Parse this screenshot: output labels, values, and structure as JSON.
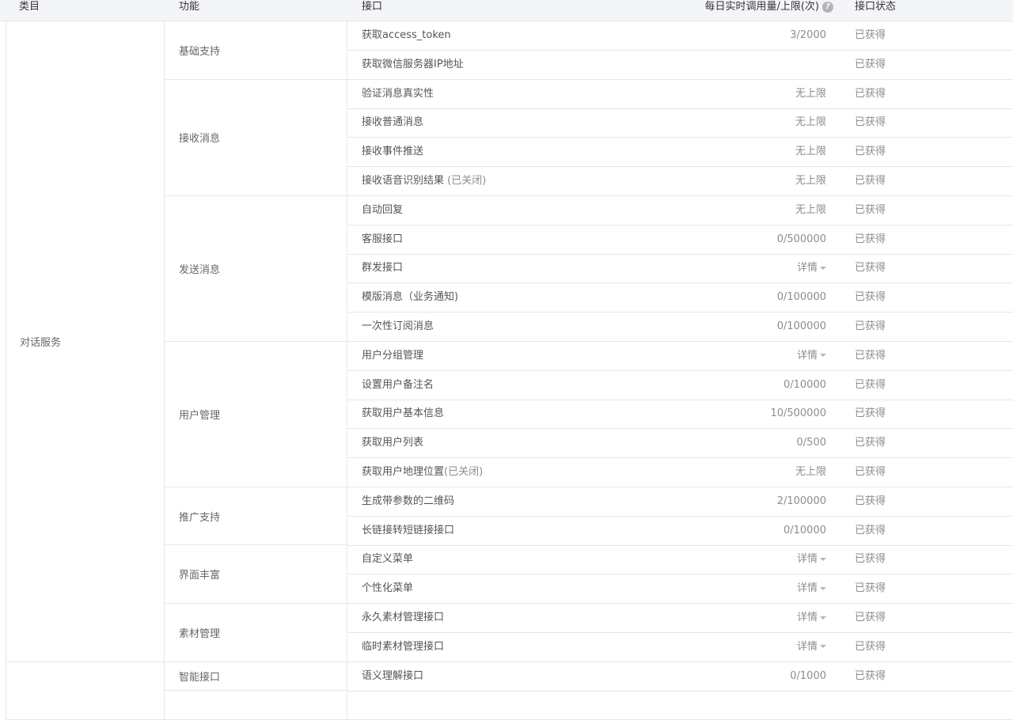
{
  "header": {
    "category": "类目",
    "function": "功能",
    "api": "接口",
    "usage": "每日实时调用量/上限(次)",
    "help_icon": "question-circle-icon",
    "status": "接口状态"
  },
  "categories": [
    {
      "label": "对话服务"
    },
    {
      "label": ""
    }
  ],
  "functions": [
    {
      "label": "基础支持"
    },
    {
      "label": "接收消息"
    },
    {
      "label": "发送消息"
    },
    {
      "label": "用户管理"
    },
    {
      "label": "推广支持"
    },
    {
      "label": "界面丰富"
    },
    {
      "label": "素材管理"
    },
    {
      "label": "智能接口"
    },
    {
      "label": ""
    }
  ],
  "rows": [
    {
      "api": "获取access_token",
      "note": "",
      "usage": "3/2000",
      "status": "已获得"
    },
    {
      "api": "获取微信服务器IP地址",
      "note": "",
      "usage": "",
      "status": "已获得"
    },
    {
      "api": "验证消息真实性",
      "note": "",
      "usage": "无上限",
      "status": "已获得"
    },
    {
      "api": "接收普通消息",
      "note": "",
      "usage": "无上限",
      "status": "已获得"
    },
    {
      "api": "接收事件推送",
      "note": "",
      "usage": "无上限",
      "status": "已获得"
    },
    {
      "api": "接收语音识别结果 ",
      "note": "(已关闭)",
      "usage": "无上限",
      "status": "已获得"
    },
    {
      "api": "自动回复",
      "note": "",
      "usage": "无上限",
      "status": "已获得"
    },
    {
      "api": "客服接口",
      "note": "",
      "usage": "0/500000",
      "status": "已获得"
    },
    {
      "api": "群发接口",
      "note": "",
      "usage": "详情",
      "status": "已获得"
    },
    {
      "api": "模版消息（业务通知)",
      "note": "",
      "usage": "0/100000",
      "status": "已获得"
    },
    {
      "api": "一次性订阅消息",
      "note": "",
      "usage": "0/100000",
      "status": "已获得"
    },
    {
      "api": "用户分组管理",
      "note": "",
      "usage": "详情",
      "status": "已获得"
    },
    {
      "api": "设置用户备注名",
      "note": "",
      "usage": "0/10000",
      "status": "已获得"
    },
    {
      "api": "获取用户基本信息",
      "note": "",
      "usage": "10/500000",
      "status": "已获得"
    },
    {
      "api": "获取用户列表",
      "note": "",
      "usage": "0/500",
      "status": "已获得"
    },
    {
      "api": "获取用户地理位置",
      "note": "(已关闭)",
      "usage": "无上限",
      "status": "已获得"
    },
    {
      "api": "生成带参数的二维码",
      "note": "",
      "usage": "2/100000",
      "status": "已获得"
    },
    {
      "api": "长链接转短链接接口",
      "note": "",
      "usage": "0/10000",
      "status": "已获得"
    },
    {
      "api": "自定义菜单",
      "note": "",
      "usage": "详情",
      "status": "已获得"
    },
    {
      "api": "个性化菜单",
      "note": "",
      "usage": "详情",
      "status": "已获得"
    },
    {
      "api": "永久素材管理接口",
      "note": "",
      "usage": "详情",
      "status": "已获得"
    },
    {
      "api": "临时素材管理接口",
      "note": "",
      "usage": "详情",
      "status": "已获得"
    },
    {
      "api": "语义理解接口",
      "note": "",
      "usage": "0/1000",
      "status": "已获得"
    },
    {
      "api": "",
      "note": "",
      "usage": "",
      "status": ""
    }
  ]
}
